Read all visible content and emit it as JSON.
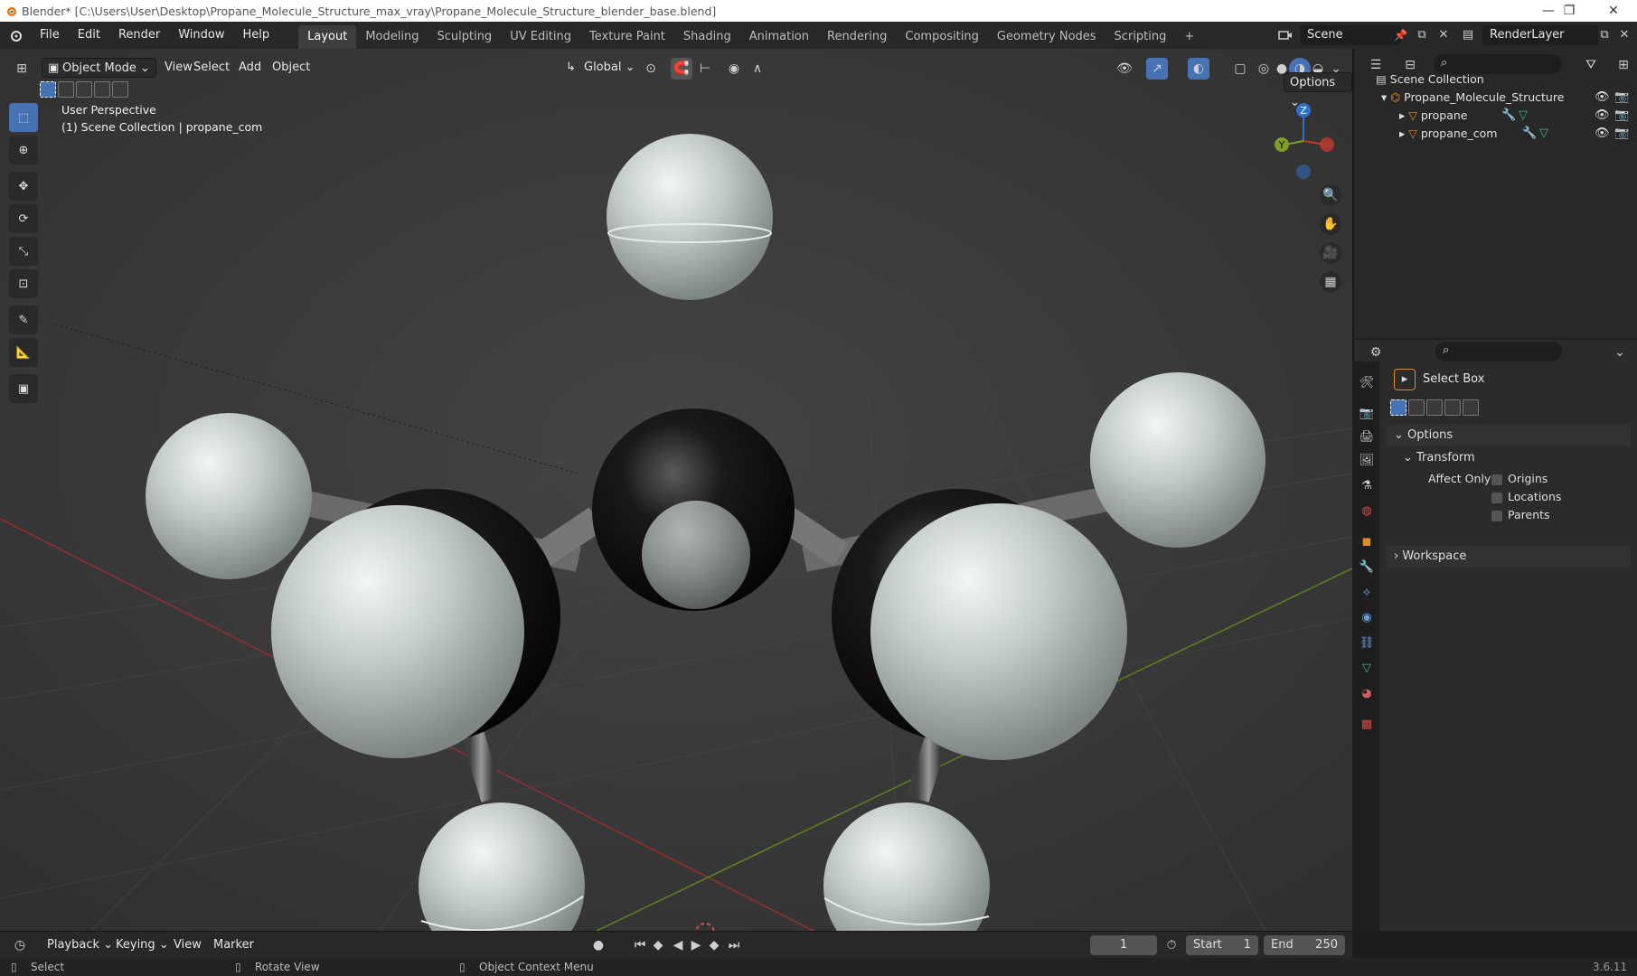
{
  "titlebar": {
    "title": "Blender* [C:\\Users\\User\\Desktop\\Propane_Molecule_Structure_max_vray\\Propane_Molecule_Structure_blender_base.blend]"
  },
  "menubar": {
    "menus": [
      "File",
      "Edit",
      "Render",
      "Window",
      "Help"
    ],
    "workspaces": [
      "Layout",
      "Modeling",
      "Sculpting",
      "UV Editing",
      "Texture Paint",
      "Shading",
      "Animation",
      "Rendering",
      "Compositing",
      "Geometry Nodes",
      "Scripting"
    ],
    "active_workspace": "Layout",
    "add_tab": "+",
    "scene_label": "Scene",
    "view_layer_label": "RenderLayer"
  },
  "viewport": {
    "mode": "Object Mode",
    "menus": [
      "View",
      "Select",
      "Add",
      "Object"
    ],
    "orientation": "Global",
    "options_label": "Options",
    "overlay_view": "User Perspective",
    "overlay_collection": "(1) Scene Collection | propane_com",
    "gizmo": {
      "z": "Z",
      "y": "Y"
    }
  },
  "outliner": {
    "scene_collection": "Scene Collection",
    "collection": "Propane_Molecule_Structure",
    "objects": [
      "propane",
      "propane_com"
    ]
  },
  "properties": {
    "tool_name": "Select Box",
    "options_header": "Options",
    "transform_header": "Transform",
    "affect_only_label": "Affect Only",
    "checkboxes": [
      "Origins",
      "Locations",
      "Parents"
    ],
    "workspace_header": "Workspace"
  },
  "timeline": {
    "menus": [
      "Playback",
      "Keying",
      "View",
      "Marker"
    ],
    "current_frame": "1",
    "start_label": "Start",
    "start_value": "1",
    "end_label": "End",
    "end_value": "250"
  },
  "statusbar": {
    "select": "Select",
    "rotate": "Rotate View",
    "context": "Object Context Menu",
    "version": "3.6.11"
  },
  "colors": {
    "accent": "#4772b3",
    "x_axis": "#c0392b",
    "y_axis": "#7ea02a",
    "z_axis": "#2f6fd0",
    "hydrogen": "#c9d2d0",
    "carbon": "#141414"
  }
}
